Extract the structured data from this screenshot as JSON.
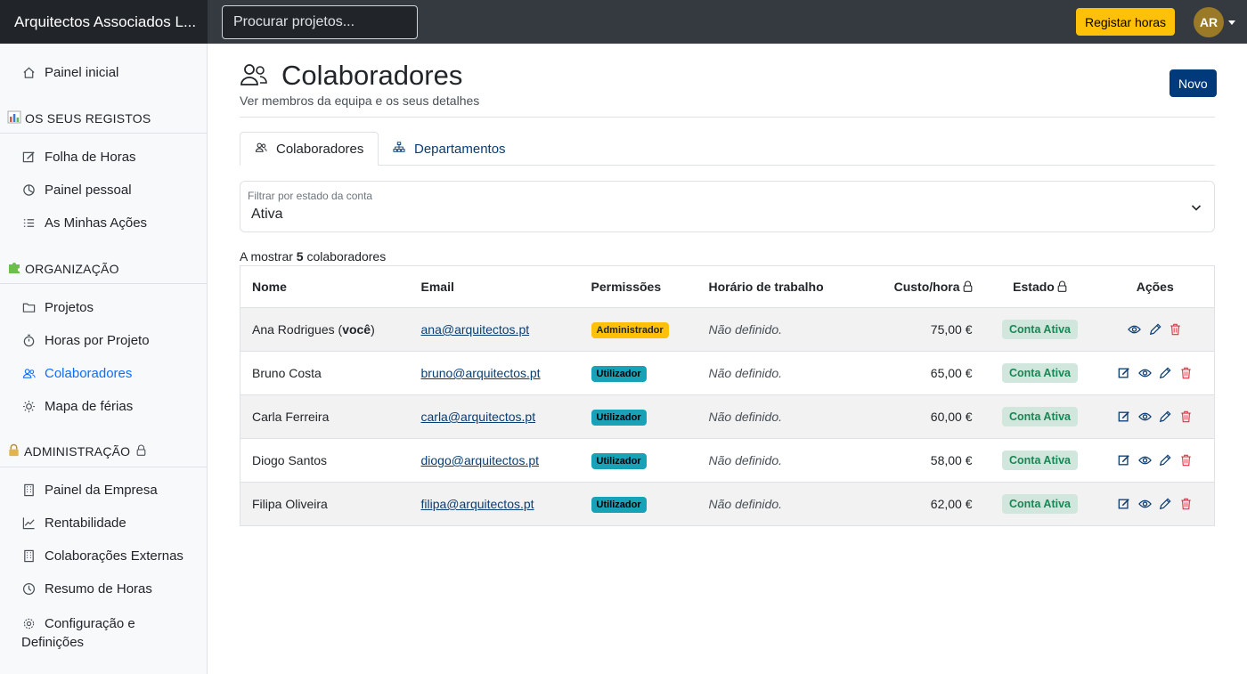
{
  "app": {
    "brand": "Arquitectos Associados L...",
    "search_placeholder": "Procurar projetos...",
    "register_hours": "Registar horas",
    "avatar_initials": "AR"
  },
  "sidebar": {
    "home": "Painel inicial",
    "section_records": "OS SEUS REGISTOS",
    "records_items": [
      "Folha de Horas",
      "Painel pessoal",
      "As Minhas Ações"
    ],
    "section_org": "ORGANIZAÇÃO",
    "org_items": [
      "Projetos",
      "Horas por Projeto",
      "Colaboradores",
      "Mapa de férias"
    ],
    "section_admin": "ADMINISTRAÇÃO",
    "admin_items": [
      "Painel da Empresa",
      "Rentabilidade",
      "Colaborações Externas",
      "Resumo de Horas"
    ],
    "config_line1": "Configuração e",
    "config_line2": "Definições",
    "active_item": "Colaboradores"
  },
  "page": {
    "title": "Colaboradores",
    "subtitle": "Ver membros da equipa e os seus detalhes",
    "new_button": "Novo",
    "tabs": [
      "Colaboradores",
      "Departamentos"
    ],
    "filter_label": "Filtrar por estado da conta",
    "filter_value": "Ativa",
    "count_prefix": "A mostrar ",
    "count_value": "5",
    "count_suffix": " colaboradores"
  },
  "table": {
    "headers": [
      "Nome",
      "Email",
      "Permissões",
      "Horário de trabalho",
      "Custo/hora",
      "Estado",
      "Ações"
    ],
    "you_suffix": "você",
    "rows": [
      {
        "name": "Ana Rodrigues",
        "is_you": true,
        "email": "ana@arquitectos.pt",
        "role": "Administrador",
        "schedule": "Não definido.",
        "cost": "75,00 €",
        "state": "Conta Ativa"
      },
      {
        "name": "Bruno Costa",
        "is_you": false,
        "email": "bruno@arquitectos.pt",
        "role": "Utilizador",
        "schedule": "Não definido.",
        "cost": "65,00 €",
        "state": "Conta Ativa"
      },
      {
        "name": "Carla Ferreira",
        "is_you": false,
        "email": "carla@arquitectos.pt",
        "role": "Utilizador",
        "schedule": "Não definido.",
        "cost": "60,00 €",
        "state": "Conta Ativa"
      },
      {
        "name": "Diogo Santos",
        "is_you": false,
        "email": "diogo@arquitectos.pt",
        "role": "Utilizador",
        "schedule": "Não definido.",
        "cost": "58,00 €",
        "state": "Conta Ativa"
      },
      {
        "name": "Filipa Oliveira",
        "is_you": false,
        "email": "filipa@arquitectos.pt",
        "role": "Utilizador",
        "schedule": "Não definido.",
        "cost": "62,00 €",
        "state": "Conta Ativa"
      }
    ]
  },
  "colors": {
    "accent": "#0d6efd",
    "primary_dark": "#003a7a",
    "warning": "#ffc107",
    "info": "#17a2b8",
    "success_bg": "#d1e7dd",
    "success_text": "#198754",
    "danger": "#dc3545"
  }
}
